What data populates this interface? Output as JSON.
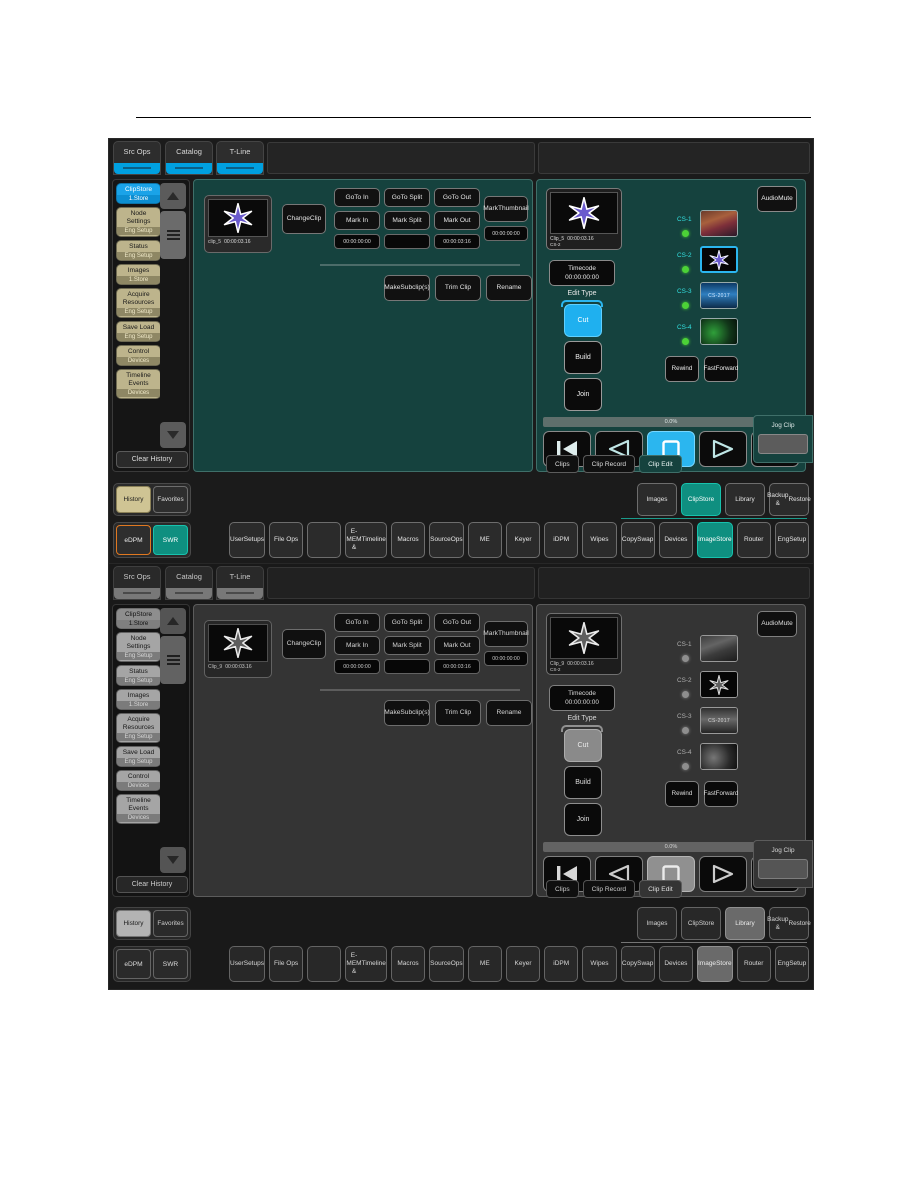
{
  "panels": [
    {
      "id": "panel-color",
      "tabs": [
        "Src Ops",
        "Catalog",
        "T-Line"
      ],
      "sidebar": {
        "items": [
          {
            "label": "ClipStore",
            "sub": "1.Store",
            "active": true
          },
          {
            "label": "Node\nSettings",
            "sub": "Eng  Setup",
            "active": false
          },
          {
            "label": "Status",
            "sub": "Eng  Setup",
            "active": false
          },
          {
            "label": "Images",
            "sub": "1.Store",
            "active": false
          },
          {
            "label": "Acquire\nResources",
            "sub": "Eng  Setup",
            "active": false
          },
          {
            "label": "Save Load",
            "sub": "Eng  Setup",
            "active": false
          },
          {
            "label": "Control",
            "sub": "Devices",
            "active": false
          },
          {
            "label": "Timeline\nEvents",
            "sub": "Devices",
            "active": false
          }
        ],
        "clear_history": "Clear History"
      },
      "workspace": {
        "clip": {
          "name": "clip_5",
          "duration": "00:00:03.16"
        },
        "change_clip": "Change\nClip",
        "goto_in": "GoTo In",
        "goto_split": "GoTo Split",
        "goto_out": "GoTo Out",
        "mark_in": "Mark In",
        "mark_split": "Mark Split",
        "mark_out": "Mark Out",
        "mark_thumbnail": "Mark\nThumbnail",
        "in_value": "00:00:00:00",
        "split_value": "",
        "out_value": "00:00:03:16",
        "thumbnail_value": "00:00:00:00",
        "make_subclips": "Make\nSubclip(s)",
        "trim_clip": "Trim Clip",
        "rename": "Rename"
      },
      "right": {
        "clip": {
          "name": "Clip_5",
          "channel": "CS-2",
          "duration": "00:00:03.16"
        },
        "audio_mute": "Audio\nMute",
        "timecode_label": "Timecode",
        "timecode_value": "00:00:00:00",
        "edit_type_label": "Edit Type",
        "edit_types": [
          {
            "label": "Cut",
            "selected": true
          },
          {
            "label": "Build",
            "selected": false
          },
          {
            "label": "Join",
            "selected": false
          }
        ],
        "channels": [
          {
            "label": "CS-1",
            "led": "#4cd137",
            "selected": false,
            "thumb": "photo"
          },
          {
            "label": "CS-2",
            "led": "#4cd137",
            "selected": true,
            "thumb": "star"
          },
          {
            "label": "CS-3",
            "led": "#4cd137",
            "selected": false,
            "thumb": "bluetext"
          },
          {
            "label": "CS-4",
            "led": "#4cd137",
            "selected": false,
            "thumb": "green"
          }
        ],
        "rewind": "Rewind",
        "fast_forward": "Fast\nForward",
        "progress": "0.0%",
        "transport": [
          {
            "icon": "skip-previous-icon",
            "selected": false
          },
          {
            "icon": "play-reverse-icon",
            "selected": false
          },
          {
            "icon": "stop-icon",
            "selected": true
          },
          {
            "icon": "play-icon",
            "selected": false
          },
          {
            "icon": "skip-next-icon",
            "selected": false
          }
        ]
      },
      "jog": {
        "label": "Jog Clip"
      },
      "subtabs": [
        {
          "label": "Clips",
          "active": false
        },
        {
          "label": "Clip Record",
          "active": false
        },
        {
          "label": "Clip Edit",
          "active": true
        }
      ],
      "history_fav": [
        {
          "label": "History",
          "on": true
        },
        {
          "label": "Favorites",
          "on": false
        }
      ],
      "group_row": [
        {
          "label": "Images",
          "on": false
        },
        {
          "label": "ClipStore",
          "on": true
        },
        {
          "label": "Library",
          "on": false
        },
        {
          "label": "Backup &\nRestore",
          "on": false
        }
      ],
      "mode_left": [
        {
          "label": "eDPM",
          "style": "edpm"
        },
        {
          "label": "SWR",
          "style": "swr"
        }
      ],
      "menu_row": [
        {
          "label": "User\nSetups",
          "on": false
        },
        {
          "label": "File Ops",
          "on": false
        },
        {
          "label": "",
          "on": false
        },
        {
          "label": "E-MEM &\nTimeline",
          "on": false
        },
        {
          "label": "Macros",
          "on": false
        },
        {
          "label": "Source\nOps",
          "on": false
        },
        {
          "label": "ME",
          "on": false
        },
        {
          "label": "Keyer",
          "on": false
        },
        {
          "label": "iDPM",
          "on": false
        },
        {
          "label": "Wipes",
          "on": false
        },
        {
          "label": "Copy\nSwap",
          "on": false
        },
        {
          "label": "Devices",
          "on": false
        },
        {
          "label": "Image\nStore",
          "on": true
        },
        {
          "label": "Router",
          "on": false
        },
        {
          "label": "Eng\nSetup",
          "on": false
        }
      ]
    },
    {
      "id": "panel-gray",
      "tabs": [
        "Src Ops",
        "Catalog",
        "T-Line"
      ],
      "sidebar": {
        "items": [
          {
            "label": "ClipStore",
            "sub": "1.Store",
            "active": true
          },
          {
            "label": "Node\nSettings",
            "sub": "Eng  Setup",
            "active": false
          },
          {
            "label": "Status",
            "sub": "Eng  Setup",
            "active": false
          },
          {
            "label": "Images",
            "sub": "1.Store",
            "active": false
          },
          {
            "label": "Acquire\nResources",
            "sub": "Eng  Setup",
            "active": false
          },
          {
            "label": "Save Load",
            "sub": "Eng  Setup",
            "active": false
          },
          {
            "label": "Control",
            "sub": "Devices",
            "active": false
          },
          {
            "label": "Timeline\nEvents",
            "sub": "Devices",
            "active": false
          }
        ],
        "clear_history": "Clear History"
      },
      "workspace": {
        "clip": {
          "name": "Clip_9",
          "duration": "00:00:03.16"
        },
        "change_clip": "Change\nClip",
        "goto_in": "GoTo In",
        "goto_split": "GoTo Split",
        "goto_out": "GoTo Out",
        "mark_in": "Mark In",
        "mark_split": "Mark Split",
        "mark_out": "Mark Out",
        "mark_thumbnail": "Mark\nThumbnail",
        "in_value": "00:00:00:00",
        "split_value": "",
        "out_value": "00:00:03:16",
        "thumbnail_value": "00:00:00:00",
        "make_subclips": "Make\nSubclip(s)",
        "trim_clip": "Trim Clip",
        "rename": "Rename"
      },
      "right": {
        "clip": {
          "name": "Clip_9",
          "channel": "CS-2",
          "duration": "00:00:03.16"
        },
        "audio_mute": "Audio\nMute",
        "timecode_label": "Timecode",
        "timecode_value": "00:00:00:00",
        "edit_type_label": "Edit Type",
        "edit_types": [
          {
            "label": "Cut",
            "selected": true
          },
          {
            "label": "Build",
            "selected": false
          },
          {
            "label": "Join",
            "selected": false
          }
        ],
        "channels": [
          {
            "label": "CS-1",
            "led": "#9a9a9a",
            "selected": false,
            "thumb": "photo"
          },
          {
            "label": "CS-2",
            "led": "#9a9a9a",
            "selected": false,
            "thumb": "star"
          },
          {
            "label": "CS-3",
            "led": "#9a9a9a",
            "selected": false,
            "thumb": "bluetext"
          },
          {
            "label": "CS-4",
            "led": "#9a9a9a",
            "selected": false,
            "thumb": "green"
          }
        ],
        "rewind": "Rewind",
        "fast_forward": "Fast\nForward",
        "progress": "0.0%",
        "transport": [
          {
            "icon": "skip-previous-icon",
            "selected": false
          },
          {
            "icon": "play-reverse-icon",
            "selected": false
          },
          {
            "icon": "stop-icon",
            "selected": true
          },
          {
            "icon": "play-icon",
            "selected": false
          },
          {
            "icon": "skip-next-icon",
            "selected": false
          }
        ]
      },
      "jog": {
        "label": "Jog Clip"
      },
      "subtabs": [
        {
          "label": "Clips",
          "active": false
        },
        {
          "label": "Clip Record",
          "active": false
        },
        {
          "label": "Clip Edit",
          "active": true
        }
      ],
      "history_fav": [
        {
          "label": "History",
          "on": true
        },
        {
          "label": "Favorites",
          "on": false
        }
      ],
      "group_row": [
        {
          "label": "Images",
          "on": false
        },
        {
          "label": "ClipStore",
          "on": false
        },
        {
          "label": "Library",
          "on": true
        },
        {
          "label": "Backup &\nRestore",
          "on": false
        }
      ],
      "mode_left": [
        {
          "label": "eDPM",
          "style": "plain"
        },
        {
          "label": "SWR",
          "style": "plain-on"
        }
      ],
      "menu_row": [
        {
          "label": "User\nSetups",
          "on": false
        },
        {
          "label": "File Ops",
          "on": false
        },
        {
          "label": "",
          "on": false
        },
        {
          "label": "E-MEM &\nTimeline",
          "on": false
        },
        {
          "label": "Macros",
          "on": false
        },
        {
          "label": "Source\nOps",
          "on": false
        },
        {
          "label": "ME",
          "on": false
        },
        {
          "label": "Keyer",
          "on": false
        },
        {
          "label": "iDPM",
          "on": false
        },
        {
          "label": "Wipes",
          "on": false
        },
        {
          "label": "Copy\nSwap",
          "on": false
        },
        {
          "label": "Devices",
          "on": false
        },
        {
          "label": "Image\nStore",
          "on": true
        },
        {
          "label": "Router",
          "on": false
        },
        {
          "label": "Eng\nSetup",
          "on": false
        }
      ]
    }
  ],
  "colors": {
    "teal_panel": "#15423e",
    "accent_blue": "#2bb6ef",
    "accent_teal": "#0f8f80",
    "tan": "#bdb48c",
    "orange": "#e07820",
    "led_green": "#4cd137"
  }
}
